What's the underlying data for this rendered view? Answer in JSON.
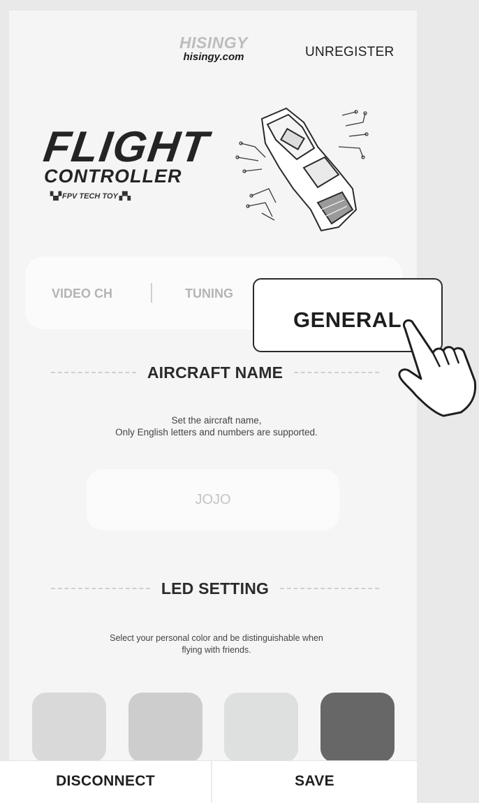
{
  "header": {
    "brand_name": "HISINGY",
    "brand_site": "hisingy.com",
    "unregister_label": "UNREGISTER"
  },
  "logo": {
    "line1": "FLIGHT",
    "line2": "CONTROLLER",
    "tagline": "FPV TECH TOY"
  },
  "tabs": [
    {
      "label": "VIDEO CH",
      "active": false
    },
    {
      "label": "TUNING",
      "active": false
    },
    {
      "label": "GENERAL",
      "active": true
    }
  ],
  "aircraft_name": {
    "heading": "AIRCRAFT NAME",
    "desc_line1": "Set the aircraft name,",
    "desc_line2": "Only English letters and numbers are supported.",
    "value": "JOJO"
  },
  "led_setting": {
    "heading": "LED SETTING",
    "desc_line1": "Select your personal color and be distinguishable when",
    "desc_line2": "flying with friends.",
    "colors": [
      "#d9d9d9",
      "#cdcdcd",
      "#dedfdf",
      "#676767"
    ]
  },
  "footer": {
    "disconnect_label": "DISCONNECT",
    "save_label": "SAVE"
  },
  "icons": [
    "flight-controller-board-icon",
    "pointing-hand-icon"
  ]
}
